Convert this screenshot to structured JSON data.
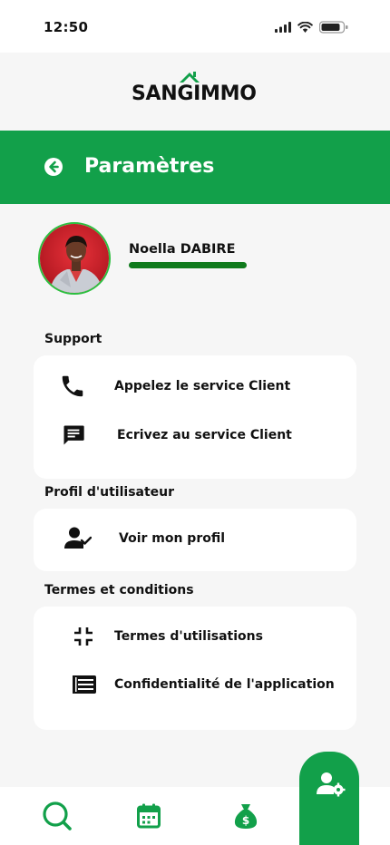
{
  "status": {
    "time": "12:50"
  },
  "brand": {
    "logo_text": "SANGIMMO"
  },
  "header": {
    "title": "Paramètres",
    "back_icon": "arrow-left-circle-icon"
  },
  "profile": {
    "name": "Noella DABIRE"
  },
  "sections": {
    "support": {
      "label": "Support",
      "items": [
        {
          "label": "Appelez le service Client",
          "icon": "phone-icon"
        },
        {
          "label": "Ecrivez au service Client",
          "icon": "message-icon"
        }
      ]
    },
    "user_profile": {
      "label": "Profil d'utilisateur",
      "items": [
        {
          "label": "Voir mon profil",
          "icon": "user-check-icon"
        }
      ]
    },
    "terms": {
      "label": "Termes et conditions",
      "items": [
        {
          "label": "Termes d'utilisations",
          "icon": "collapse-icon"
        },
        {
          "label": "Confidentialité de l'application",
          "icon": "document-list-icon"
        }
      ]
    }
  },
  "nav": {
    "items": [
      "search-icon",
      "calendar-icon",
      "money-bag-icon",
      "user-settings-icon"
    ],
    "active": "user-settings-icon"
  },
  "colors": {
    "primary": "#12a04a",
    "progress": "#0f7a1c",
    "background": "#f6f6f6"
  }
}
